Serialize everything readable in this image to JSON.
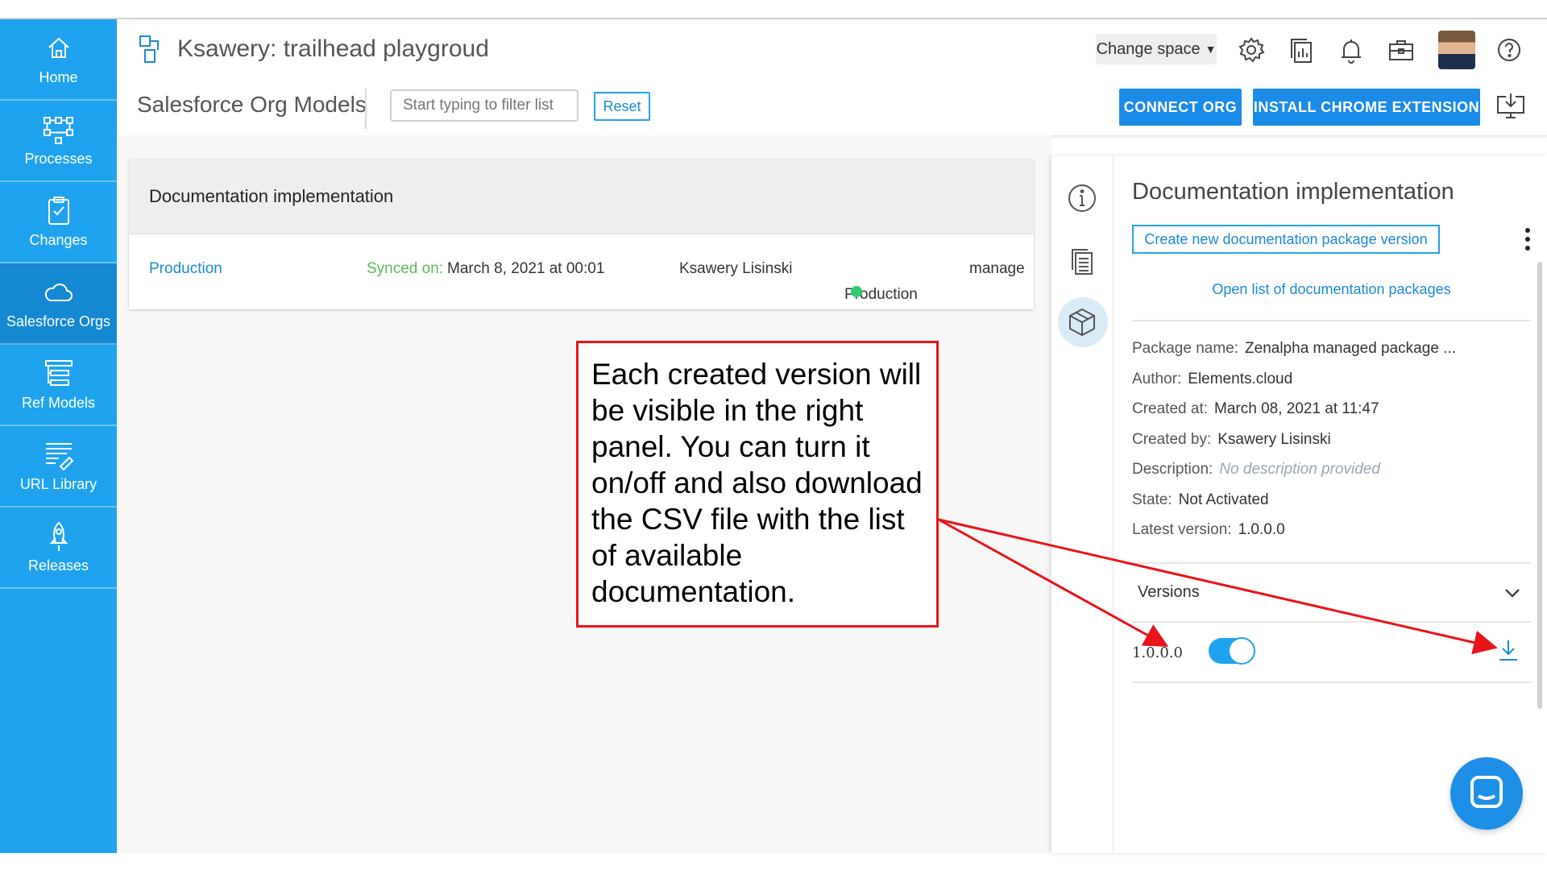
{
  "sidebar": {
    "items": [
      {
        "label": "Home",
        "icon": "home-icon"
      },
      {
        "label": "Processes",
        "icon": "processes-icon"
      },
      {
        "label": "Changes",
        "icon": "clipboard-icon"
      },
      {
        "label": "Salesforce Orgs",
        "icon": "cloud-icon",
        "active": true
      },
      {
        "label": "Ref Models",
        "icon": "ref-models-icon"
      },
      {
        "label": "URL Library",
        "icon": "url-library-icon"
      },
      {
        "label": "Releases",
        "icon": "rocket-icon"
      }
    ]
  },
  "header": {
    "title": "Ksawery: trailhead playgroud",
    "change_space": "Change space"
  },
  "toolbar": {
    "page_title": "Salesforce Org Models",
    "filter_placeholder": "Start typing to filter list",
    "reset_label": "Reset",
    "connect_label": "CONNECT ORG",
    "install_label": "INSTALL CHROME EXTENSION"
  },
  "card": {
    "title": "Documentation implementation",
    "row": {
      "org": "Production",
      "synced_label": "Synced on:",
      "synced_value": "March 8, 2021 at 00:01",
      "user": "Ksawery Lisinski",
      "env": "Production",
      "action": "manage"
    }
  },
  "callout": {
    "text": "Each created version will be visible in the right panel. You can turn it on/off and also download the CSV file with the list of available documentation."
  },
  "panel": {
    "title": "Documentation implementation",
    "create_label": "Create new documentation package version",
    "open_list": "Open list of documentation packages",
    "meta": [
      {
        "label": "Package name:",
        "value": "Zenalpha managed package ..."
      },
      {
        "label": "Author:",
        "value": "Elements.cloud"
      },
      {
        "label": "Created at:",
        "value": "March 08, 2021 at 11:47"
      },
      {
        "label": "Created by:",
        "value": "Ksawery Lisinski"
      },
      {
        "label": "Description:",
        "value": "No description provided"
      },
      {
        "label": "State:",
        "value": "Not Activated"
      },
      {
        "label": "Latest version:",
        "value": "1.0.0.0"
      }
    ],
    "versions_label": "Versions",
    "version": {
      "number": "1.0.0.0",
      "enabled": true
    }
  },
  "colors": {
    "sidebar": "#1fa3ee",
    "sidebar_active": "#1488d3",
    "accent": "#1a8be6",
    "link": "#1b8ad1",
    "synced": "#5cb85c",
    "status_dot": "#2ecc71",
    "annotation": "#e8141a"
  }
}
